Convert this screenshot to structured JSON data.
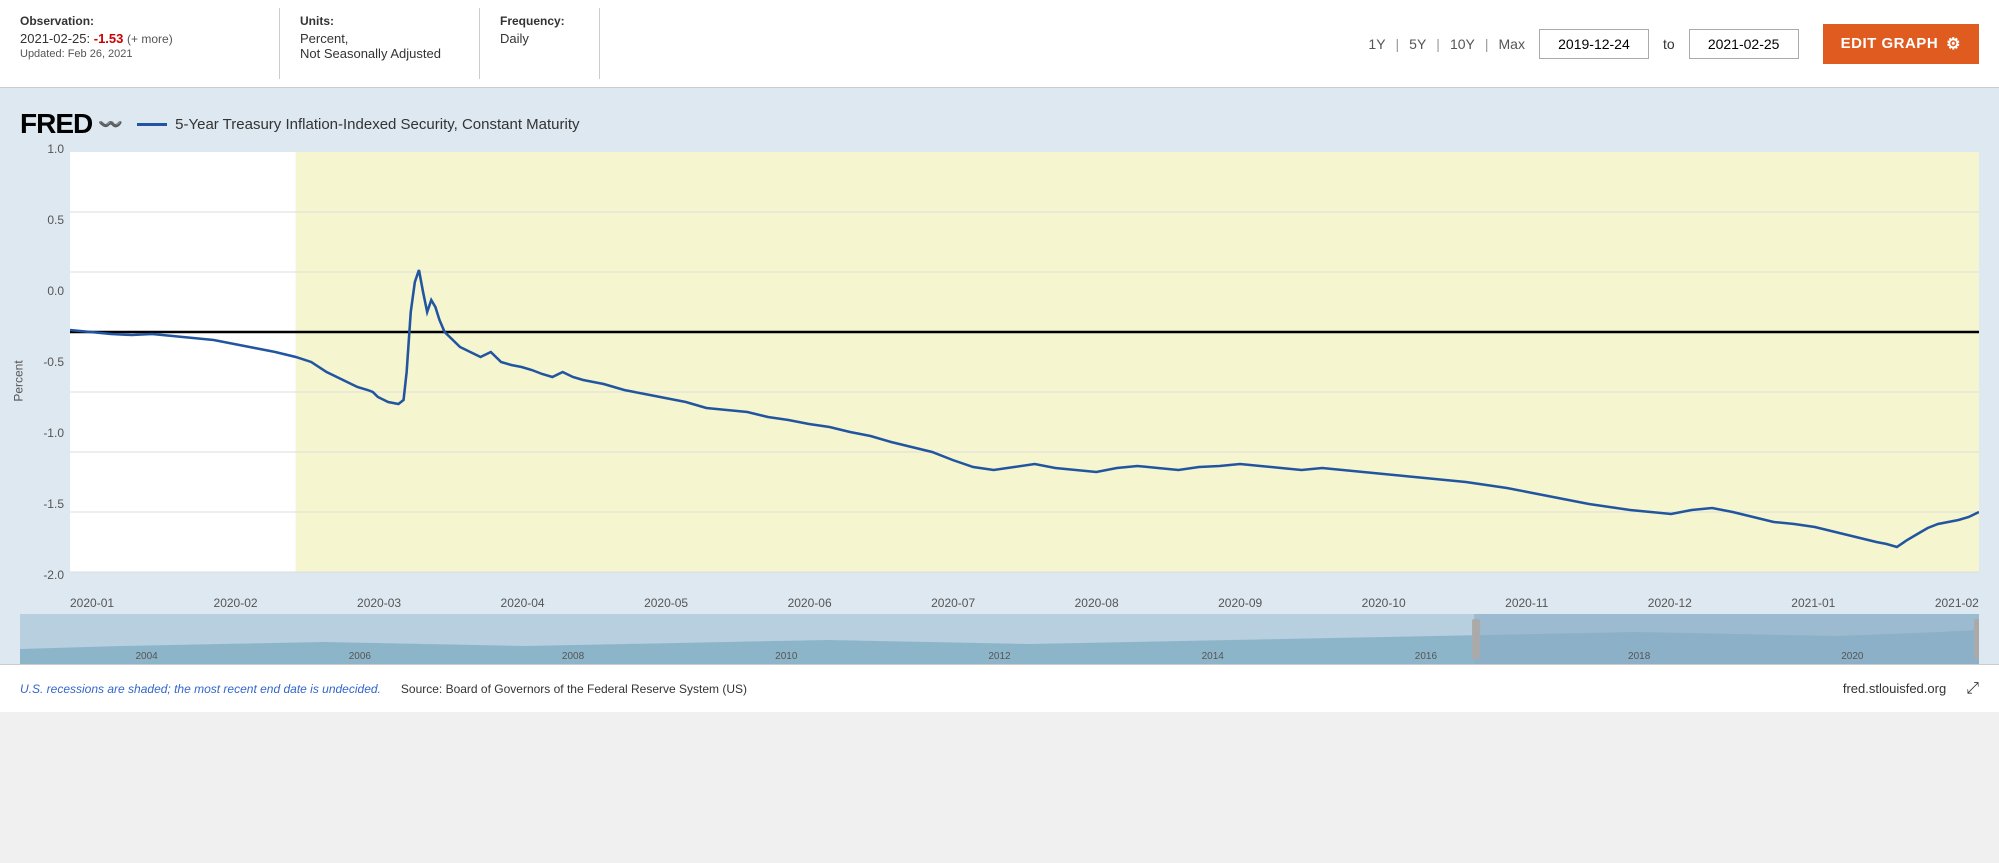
{
  "header": {
    "observation_label": "Observation:",
    "observation_date": "2021-02-25:",
    "observation_value": "-1.53",
    "observation_more": "(+ more)",
    "updated_label": "Updated: Feb 26, 2021",
    "units_label": "Units:",
    "units_value": "Percent,",
    "units_detail": "Not Seasonally Adjusted",
    "frequency_label": "Frequency:",
    "frequency_value": "Daily",
    "range_1y": "1Y",
    "range_5y": "5Y",
    "range_10y": "10Y",
    "range_max": "Max",
    "date_from": "2019-12-24",
    "date_to": "2021-02-25",
    "to_label": "to",
    "edit_button": "EDIT GRAPH"
  },
  "chart": {
    "fred_logo": "FRED",
    "legend_label": "5-Year Treasury Inflation-Indexed Security, Constant Maturity",
    "y_axis_label": "Percent",
    "x_labels": [
      "2020-01",
      "2020-02",
      "2020-03",
      "2020-04",
      "2020-05",
      "2020-06",
      "2020-07",
      "2020-08",
      "2020-09",
      "2020-10",
      "2020-11",
      "2020-12",
      "2021-01",
      "2021-02"
    ],
    "y_labels": [
      "1.0",
      "0.5",
      "0.0",
      "-0.5",
      "-1.0",
      "-1.5",
      "-2.0"
    ]
  },
  "minimap": {
    "labels": [
      "2004",
      "2006",
      "2008",
      "2010",
      "2012",
      "2014",
      "2016",
      "2018",
      "2020"
    ]
  },
  "footer": {
    "recession_text": "U.S. recessions are shaded; the most recent end date is undecided.",
    "source_text": "Source: Board of Governors of the Federal Reserve System (US)",
    "fred_url": "fred.stlouisfed.org",
    "expand_icon": "⤢"
  },
  "icons": {
    "gear": "⚙",
    "squiggle": "〰"
  }
}
